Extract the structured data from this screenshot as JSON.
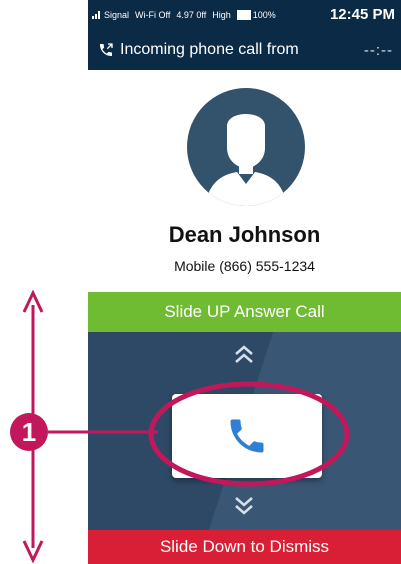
{
  "status_bar": {
    "signal_label": "Signal",
    "wifi_label": "Wi-Fi Off",
    "network_label": "4.97 0ff",
    "strength_label": "High",
    "battery_label": "100%",
    "time": "12:45 PM"
  },
  "header": {
    "title": "Incoming phone call from",
    "call_timer": "--:--",
    "icon": "phone-incoming-icon"
  },
  "caller": {
    "avatar_icon": "person-silhouette-icon",
    "name": "Dean Johnson",
    "number": "Mobile (866) 555-1234"
  },
  "actions": {
    "answer_label": "Slide UP Answer Call",
    "dismiss_label": "Slide Down to Dismiss",
    "call_button_icon": "phone-icon"
  },
  "annotation": {
    "callout_number": "1"
  },
  "colors": {
    "header_bg": "#0b2a45",
    "answer_green": "#6fbb32",
    "dismiss_red": "#d81f36",
    "slide_bg": "#2e4966",
    "phone_blue": "#2f7fd4",
    "callout_magenta": "#c2185b"
  }
}
